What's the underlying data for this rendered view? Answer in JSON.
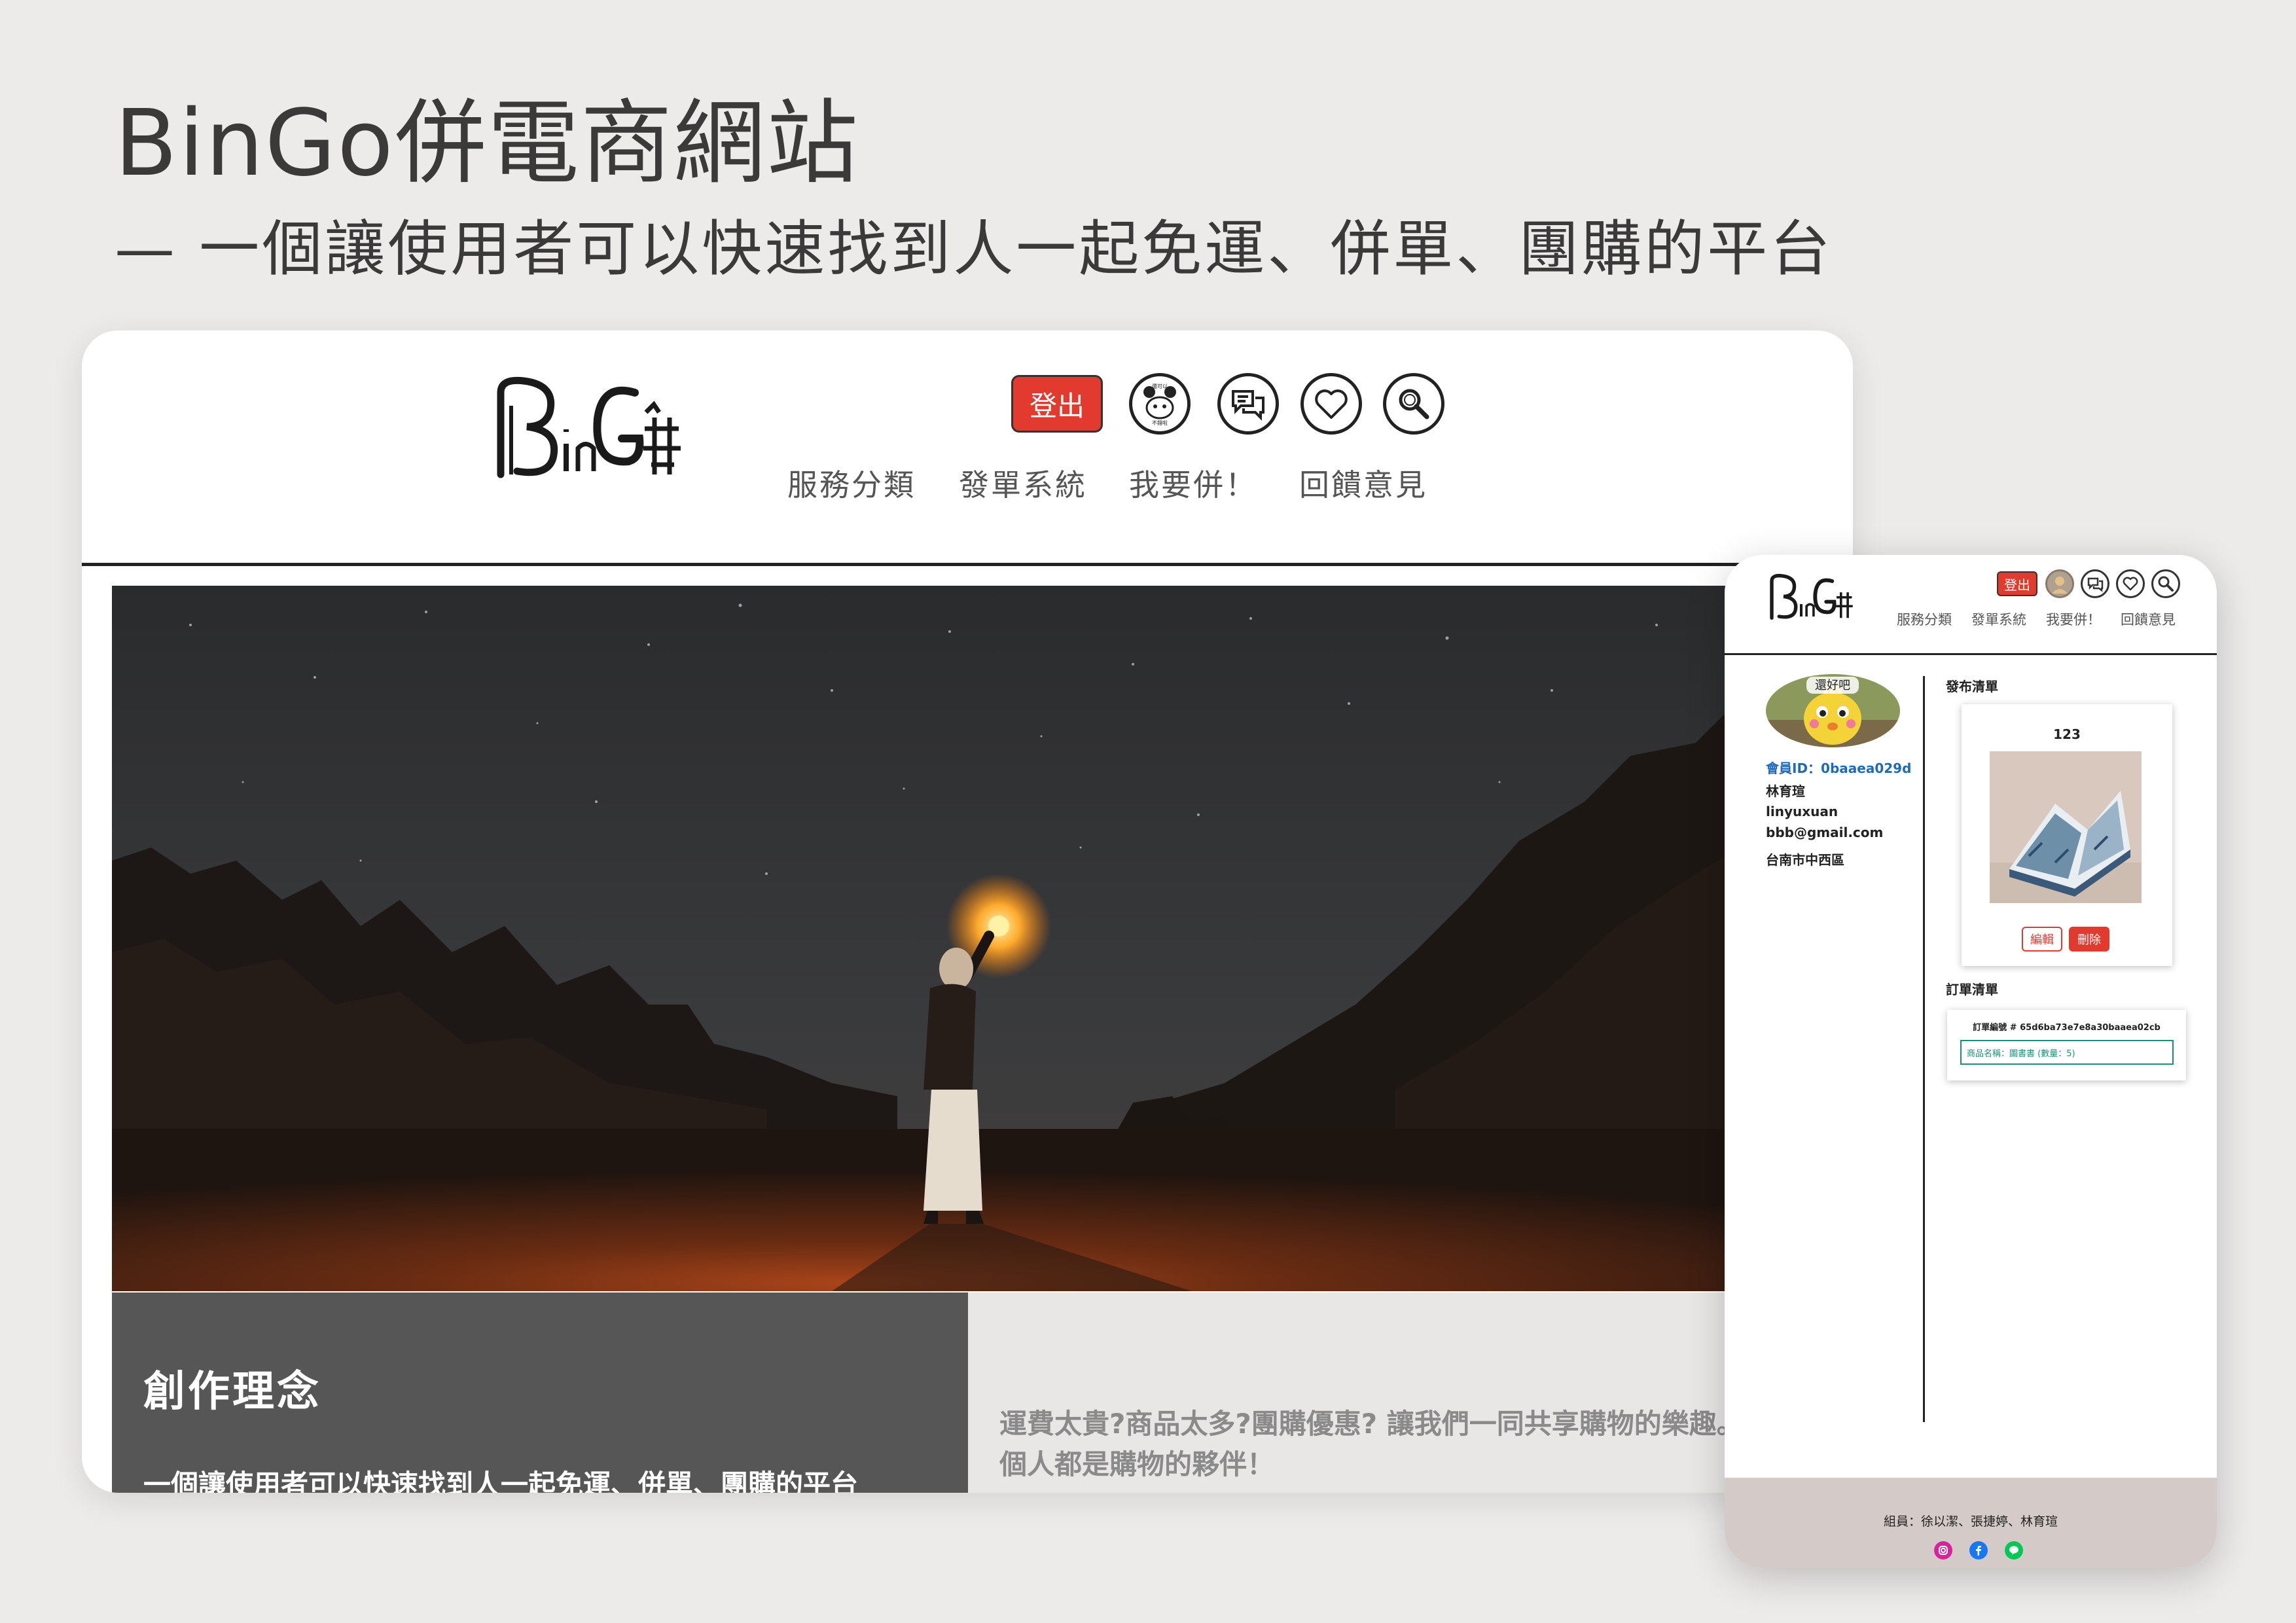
{
  "header": {
    "title": "BinGo併電商網站",
    "subtitle": "— 一個讓使用者可以快速找到人一起免運、併單、團購的平台"
  },
  "desktop": {
    "logout_label": "登出",
    "avatar_caption_top": "還可以",
    "avatar_caption_bottom": "不錯啦",
    "nav": [
      "服務分類",
      "發單系統",
      "我要併！",
      "回饋意見"
    ],
    "about_title": "創作理念",
    "about_text": "一個讓使用者可以快速找到人一起免運、併單、團購的平台",
    "about_body": "運費太貴?商品太多?團購優惠? 讓我們一同共享購物的樂趣。 在這裡，每個人都是購物的夥伴！"
  },
  "mobile": {
    "logout_label": "登出",
    "nav": [
      "服務分類",
      "發單系統",
      "我要併！",
      "回饋意見"
    ],
    "avatar_caption": "還好吧",
    "member_id": "會員ID：0baaea029d",
    "name": "林育瑄",
    "username": "linyuxuan",
    "email": "bbb@gmail.com",
    "address": "台南市中西區",
    "posted_list_label": "發布清單",
    "card_title": "123",
    "edit_label": "編輯",
    "delete_label": "刪除",
    "order_list_label": "訂單清單",
    "order_number": "訂單編號 # 65d6ba73e7e8a30baaea02cb",
    "order_item": "商品名稱：圖書書 (數量：5)",
    "footer_members": "組員：徐以潔、張捷婷、林育瑄"
  },
  "colors": {
    "background": "#ecebea",
    "accent_red": "#e23a2f",
    "about_dark": "#565656",
    "about_light": "#e8e7e6",
    "footer": "#d4cbc8",
    "member_id_blue": "#1f6bb8",
    "order_teal": "#1b8f7a"
  },
  "icons": [
    "avatar-icon",
    "chat-icon",
    "heart-icon",
    "search-icon",
    "instagram-icon",
    "facebook-icon",
    "line-icon"
  ]
}
